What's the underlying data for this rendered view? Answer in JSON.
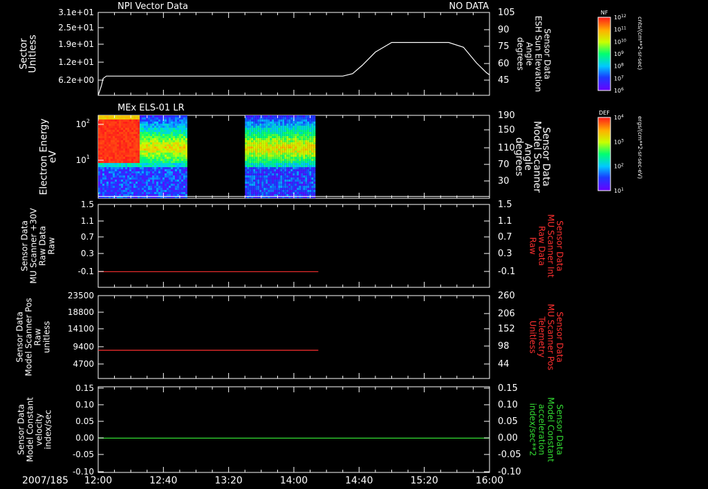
{
  "header": {
    "left_title": "NPI Vector Data",
    "right_status": "NO DATA"
  },
  "date_label": "2007/185",
  "time_axis": {
    "range_min": [
      0,
      240
    ],
    "ticks": [
      {
        "t": 0,
        "label": "12:00"
      },
      {
        "t": 40,
        "label": "12:40"
      },
      {
        "t": 80,
        "label": "13:20"
      },
      {
        "t": 120,
        "label": "14:00"
      },
      {
        "t": 160,
        "label": "14:40"
      },
      {
        "t": 200,
        "label": "15:20"
      },
      {
        "t": 240,
        "label": "16:00"
      }
    ]
  },
  "colors": {
    "white": "#ffffff",
    "red": "#ff3030",
    "green": "#33dd33"
  },
  "panels": [
    {
      "id": "p1",
      "left_label": [
        "Sector",
        "Unitless"
      ],
      "left_ticks": [
        "3.1e+01",
        "2.5e+01",
        "1.9e+01",
        "1.2e+01",
        "6.2e+00"
      ],
      "right_ticks": [
        "105",
        "90",
        "75",
        "60",
        "45"
      ],
      "right_label": [
        "Sensor Data",
        "ESH Sun Elevation",
        "Angle",
        "degrees"
      ],
      "right_label_color": "#ffffff"
    },
    {
      "id": "p2",
      "title": "MEx ELS-01 LR",
      "left_label": [
        "Electron Energy",
        "eV"
      ],
      "left_ticks": [
        "10",
        "10"
      ],
      "left_tick_exps": [
        "2",
        "1"
      ],
      "right_ticks": [
        "190",
        "150",
        "110",
        "70",
        "30"
      ],
      "right_label": [
        "Sensor Data",
        "Model Scanner",
        "Angle",
        "degrees"
      ],
      "right_label_color": "#ffffff"
    },
    {
      "id": "p3",
      "left_label": [
        "Sensor Data",
        "MU Scanner +30V",
        "Raw Data",
        "Raw"
      ],
      "left_ticks": [
        "1.5",
        "1.1",
        "0.7",
        "0.3",
        "-0.1"
      ],
      "right_ticks": [
        "1.5",
        "1.1",
        "0.7",
        "0.3",
        "-0.1"
      ],
      "right_label": [
        "Sensor Data",
        "MU Scanner Int",
        "Raw Data",
        "Raw"
      ],
      "right_label_color": "#ff3030"
    },
    {
      "id": "p4",
      "left_label": [
        "Sensor Data",
        "Model Scanner Pos",
        "Raw",
        "unitless"
      ],
      "left_ticks": [
        "23500",
        "18800",
        "14100",
        "9400",
        "4700"
      ],
      "right_ticks": [
        "260",
        "206",
        "152",
        "98",
        "44"
      ],
      "right_label": [
        "Sensor Data",
        "MU Scanner Pos",
        "Telemetry",
        "Unitless"
      ],
      "right_label_color": "#ff3030"
    },
    {
      "id": "p5",
      "left_label": [
        "Sensor Data",
        "Model Constant",
        "velocity",
        "index/sec"
      ],
      "left_ticks": [
        "0.15",
        "0.10",
        "0.05",
        "0.00",
        "-0.05",
        "-0.10"
      ],
      "right_ticks": [
        "0.15",
        "0.10",
        "0.05",
        "0.00",
        "-0.05",
        "-0.10"
      ],
      "right_label": [
        "Sensor Data",
        "Model Constant",
        "acceleration",
        "index/sec**2"
      ],
      "right_label_color": "#33dd33"
    }
  ],
  "colorbars": [
    {
      "name": "NF",
      "units": "cnts/(cm**2-sr-sec)",
      "exp_labels": [
        "12",
        "11",
        "10",
        "9",
        "8",
        "7",
        "6"
      ]
    },
    {
      "name": "DEF",
      "units": "ergs/(cm**2-sr-sec-eV)",
      "exp_labels": [
        "4",
        "3",
        "2",
        "1"
      ]
    }
  ],
  "chart_data": [
    {
      "type": "line",
      "panel": "p1",
      "xlabel": "",
      "ylabel": "Sector Unitless",
      "y2label": "Sensor Data ESH Sun Elevation Angle degrees",
      "xlim": [
        0,
        240
      ],
      "y2lim": [
        36,
        105
      ],
      "series": [
        {
          "values_axis": "right",
          "color": "#ffffff",
          "x": [
            0,
            2,
            3,
            5,
            150,
            156,
            162,
            170,
            180,
            200,
            215,
            224,
            232,
            238,
            240
          ],
          "y": [
            36,
            44,
            50,
            52,
            52,
            54,
            61,
            72,
            80,
            80,
            80,
            76,
            63,
            55,
            53
          ]
        }
      ]
    },
    {
      "type": "heatmap",
      "panel": "p2",
      "ylabel": "Electron Energy eV",
      "y2label": "Sensor Data Model Scanner Angle degrees",
      "xlim": [
        0,
        240
      ],
      "data_intervals": [
        [
          0,
          54
        ],
        [
          90,
          133
        ]
      ],
      "y2_line_value": 14
    },
    {
      "type": "line",
      "panel": "p3",
      "ylabel": "Sensor Data MU Scanner +30V Raw Data Raw",
      "xlim": [
        0,
        240
      ],
      "ylim": [
        -0.35,
        1.5
      ],
      "series": [
        {
          "color": "#ff3030",
          "x": [
            0,
            135
          ],
          "y": [
            0,
            0
          ]
        }
      ]
    },
    {
      "type": "line",
      "panel": "p4",
      "ylabel": "Sensor Data Model Scanner Pos Raw unitless",
      "xlim": [
        0,
        240
      ],
      "ylim": [
        0,
        23500
      ],
      "series": [
        {
          "color": "#ff3030",
          "x": [
            0,
            135
          ],
          "y": [
            8000,
            8000
          ]
        }
      ]
    },
    {
      "type": "line",
      "panel": "p5",
      "ylabel": "Sensor Data Model Constant velocity index/sec",
      "xlim": [
        0,
        240
      ],
      "ylim": [
        -0.1,
        0.15
      ],
      "series": [
        {
          "color": "#33dd33",
          "x": [
            0,
            240
          ],
          "y": [
            0,
            0
          ]
        }
      ]
    }
  ]
}
